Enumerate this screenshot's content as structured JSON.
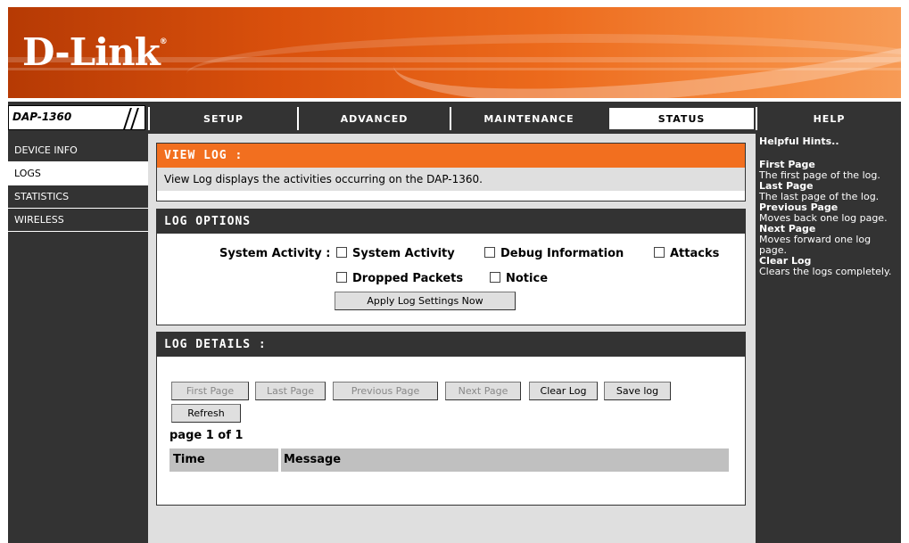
{
  "brand": {
    "logo": "D-Link",
    "registered": "®"
  },
  "model": "DAP-1360",
  "nav": {
    "tabs": [
      {
        "label": "SETUP"
      },
      {
        "label": "ADVANCED"
      },
      {
        "label": "MAINTENANCE"
      },
      {
        "label": "STATUS",
        "active": true
      },
      {
        "label": "HELP"
      }
    ]
  },
  "sidebar": {
    "items": [
      {
        "label": "DEVICE INFO"
      },
      {
        "label": "LOGS",
        "active": true
      },
      {
        "label": "STATISTICS"
      },
      {
        "label": "WIRELESS"
      }
    ]
  },
  "viewlog": {
    "title": "VIEW LOG :",
    "description": "View Log displays the activities occurring on the DAP-1360."
  },
  "log_options": {
    "title": "LOG OPTIONS",
    "label": "System Activity :",
    "checkboxes": [
      {
        "label": "System Activity",
        "checked": false
      },
      {
        "label": "Debug Information",
        "checked": false
      },
      {
        "label": "Attacks",
        "checked": false
      },
      {
        "label": "Dropped Packets",
        "checked": false
      },
      {
        "label": "Notice",
        "checked": false
      }
    ],
    "apply_button": "Apply Log Settings Now"
  },
  "log_details": {
    "title": "LOG DETAILS :",
    "buttons": {
      "first_page": "First Page",
      "last_page": "Last Page",
      "previous_page": "Previous Page",
      "next_page": "Next Page",
      "clear_log": "Clear Log",
      "save_log": "Save log",
      "refresh": "Refresh"
    },
    "page_info": "page 1 of 1",
    "columns": {
      "time": "Time",
      "message": "Message"
    }
  },
  "help": {
    "title": "Helpful Hints..",
    "hints": [
      {
        "term": "First Page",
        "text": "The first page of the log."
      },
      {
        "term": "Last Page",
        "text": "The last page of the log."
      },
      {
        "term": "Previous Page",
        "text": "Moves back one log page."
      },
      {
        "term": "Next Page",
        "text": "Moves forward one log page."
      },
      {
        "term": "Clear Log",
        "text": "Clears the logs completely."
      }
    ]
  },
  "colors": {
    "orange": "#f26f1f",
    "dark": "#333333",
    "grey": "#dfdfdf"
  }
}
